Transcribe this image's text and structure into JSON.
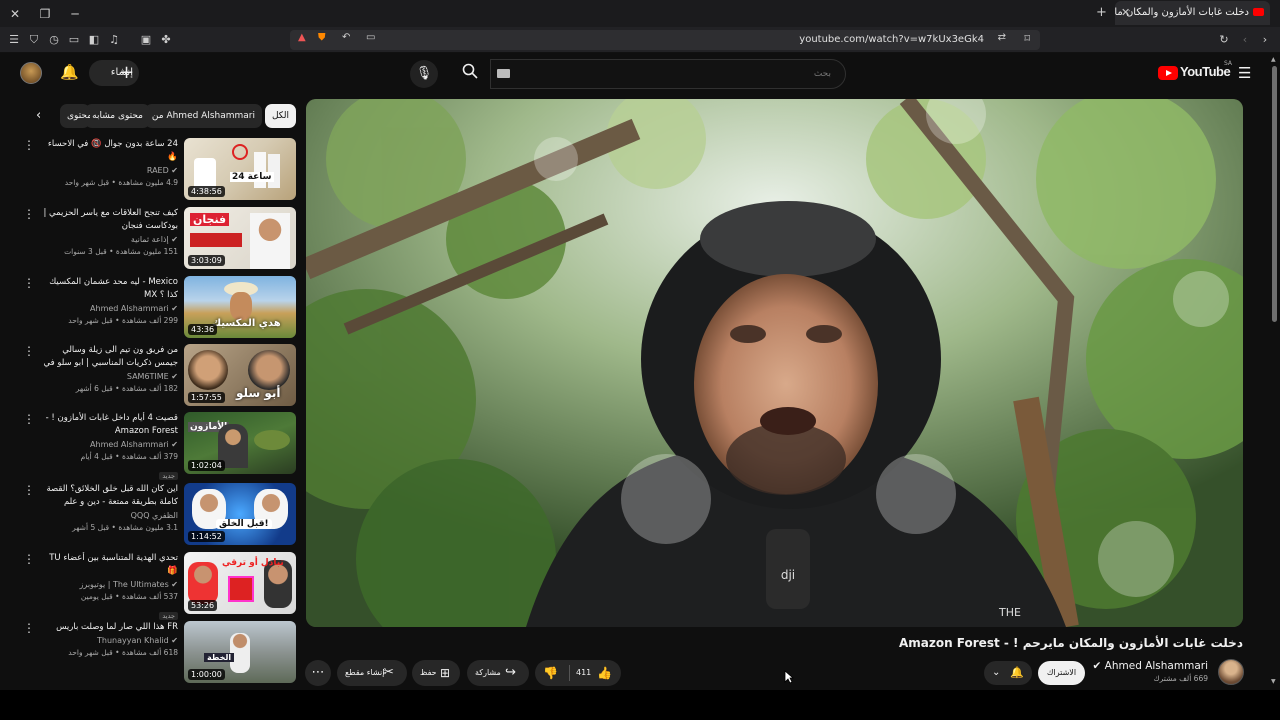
{
  "browser": {
    "tab_title": "دخلت غابات الأمازون والمكان ما",
    "url": "youtube.com/watch?v=w7kUx3eGk4"
  },
  "header": {
    "create_label": "إنشاء",
    "search_placeholder": "بحث",
    "logo_text": "YouTube",
    "logo_country": "SA"
  },
  "chips": [
    "الكل",
    "من Ahmed Alshammari",
    "محتوى مشابه",
    "محتوى"
  ],
  "videos": [
    {
      "title": "24 ساعة بدون جوال 📵 في الاحساء 🔥",
      "channel": "RAED",
      "stats": "4.9 مليون مشاهدة • قبل شهر واحد",
      "duration": "4:38:56"
    },
    {
      "title": "كيف تنجح العلاقات مع ياسر الحزيمي | بودكاست فنجان",
      "channel": "إذاعة ثمانية",
      "stats": "151 مليون مشاهدة • قبل 3 سنوات",
      "duration": "3:03:09"
    },
    {
      "title": "Mexico - ليه محد عشمان المكسيك كذا ؟ MX",
      "channel": "Ahmed Alshammari",
      "stats": "299 ألف مشاهدة • قبل شهر واحد",
      "duration": "43:36"
    },
    {
      "title": "من فريق ون تيم الى زيلة وسالي جيمس ذكريات المناسبي | ابو سلو في بودكاست ثكي...",
      "channel": "SAM6TIME",
      "stats": "182 ألف مشاهدة • قبل 6 أشهر",
      "duration": "1:57:55"
    },
    {
      "title": "قصيت 4 أيام داخل غابات الأمازون ! - Amazon Forest",
      "channel": "Ahmed Alshammari",
      "stats": "379 ألف مشاهدة • قبل 4 أيام",
      "duration": "1:02:04",
      "tag": "جديد"
    },
    {
      "title": "اين كان الله قبل خلق الخلائق؟ القصة كاملة بطريقة ممتعة - دين و علم",
      "channel": "الظفري QQQ",
      "stats": "3.1 مليون مشاهدة • قبل 5 أشهر",
      "duration": "1:14:52"
    },
    {
      "title": "تحدي الهدية المتناسبة بين أعضاء TU 🎁",
      "channel": "The Ultimates | يوتيوبرز",
      "stats": "537 ألف مشاهدة • قبل يومين",
      "duration": "53:26",
      "tag": "جديد"
    },
    {
      "title": "FR هذا اللي صار لما وصلت باريس",
      "channel": "Thunayyan Khalid",
      "stats": "618 ألف مشاهدة • قبل شهر واحد",
      "duration": "1:00:00"
    }
  ],
  "thumb_captions": [
    "24 ساعة",
    "فنجان",
    "هدي المكسيك",
    "أبو سلو",
    "الأمازون",
    "قبل الخلق!",
    "تبادل أو ترقي",
    "الخطة"
  ],
  "watch": {
    "title": "دخلت غابات الأمازون والمكان مايرحم ! - Amazon Forest",
    "channel_name": "Ahmed Alshammari",
    "subscribers": "669 ألف مشترك",
    "subscribe_label": "الاشتراك",
    "likes": "411",
    "share_label": "مشاركة",
    "save_label": "حفظ",
    "clip_label": "إنشاء مقطع",
    "dji_label": "dji",
    "jacket_text": "THE"
  },
  "colors": {
    "brand_red": "#ff0000",
    "background": "#0f0f0f",
    "surface": "#272727"
  }
}
